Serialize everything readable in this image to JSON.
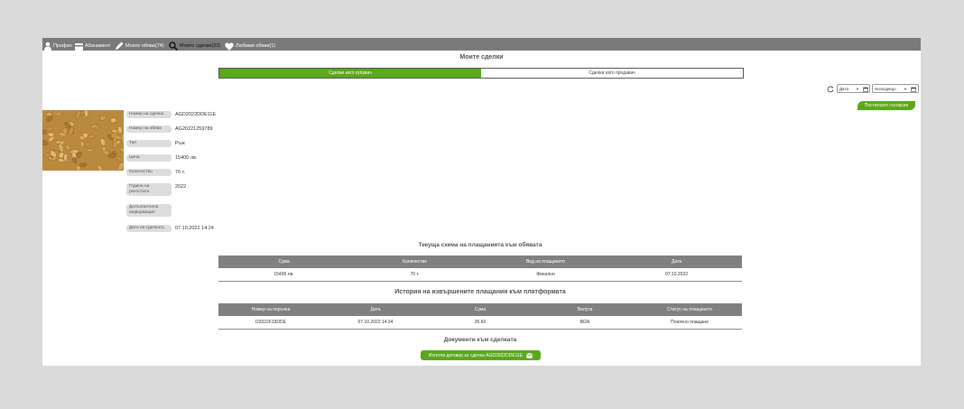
{
  "nav": {
    "items": [
      {
        "label": "Профил",
        "icon": "user-icon"
      },
      {
        "label": "Абонамент",
        "icon": "card-icon"
      },
      {
        "label": "Моите обяви(74)",
        "icon": "pencil-icon"
      },
      {
        "label": "Моите сделки(32)",
        "icon": "search-icon"
      },
      {
        "label": "Любими обяви(1)",
        "icon": "heart-icon"
      }
    ]
  },
  "page": {
    "title": "Моите сделки"
  },
  "tabs": [
    {
      "label": "Сделки като купувач",
      "active": true
    },
    {
      "label": "Сделки като продавач",
      "active": false
    }
  ],
  "filters": {
    "date_label": "Дата",
    "order_label": "Низходящо",
    "refresh_icon": "refresh-icon",
    "calendar_icon": "calendar-icon"
  },
  "reached_agreement_label": "Постигнато съгласие",
  "deal": {
    "image": "wheat-grain-photo",
    "fields": [
      {
        "label": "Номер на сделка",
        "value": "AGD2022DDE11E"
      },
      {
        "label": "Номер на обява",
        "value": "AG20221259789"
      },
      {
        "label": "Тип",
        "value": "Ръж"
      },
      {
        "label": "Цена",
        "value": "15400 лв."
      },
      {
        "label": "Количество",
        "value": "70 т."
      },
      {
        "label": "Година на реколтата",
        "value": "2022"
      },
      {
        "label": "Допълнителна информация",
        "value": ""
      },
      {
        "label": "Дата на сделката",
        "value": "07.10.2022 14:24"
      }
    ]
  },
  "payment_scheme": {
    "title": "Текуща схема на плащанията към обявата",
    "headers": [
      "Сума",
      "Количество",
      "Вид на плащането",
      "Дата"
    ],
    "rows": [
      [
        "15400 лв.",
        "70 т.",
        "Финално",
        "07.10.2022"
      ]
    ]
  },
  "payments_history": {
    "title": "История на извършените плащания към платформата",
    "headers": [
      "Номер на поръчка",
      "Дата",
      "Сума",
      "Валута",
      "Статус на плащането"
    ],
    "rows": [
      [
        "D2022F33DDE",
        "07.10.2022 14:24",
        "35.60",
        "BGN",
        "Платено плащане"
      ]
    ]
  },
  "documents": {
    "title": "Документи към сделката",
    "download_label": "Изтегли договор за сделка AGD2022DDE11E",
    "download_icon": "document-icon"
  },
  "colors": {
    "accent_green": "#5aa81c",
    "topbar": "#7a7a7a",
    "table_header": "#808080"
  }
}
